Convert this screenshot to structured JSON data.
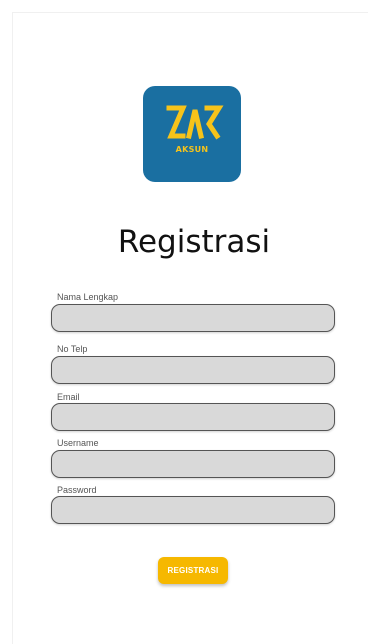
{
  "logo": {
    "text": "AKSUN",
    "background_color": "#1a6fa1",
    "accent_color": "#f6c31a"
  },
  "page": {
    "title": "Registrasi"
  },
  "form": {
    "fields": [
      {
        "label": "Nama Lengkap",
        "value": ""
      },
      {
        "label": "No Telp",
        "value": ""
      },
      {
        "label": "Email",
        "value": ""
      },
      {
        "label": "Username",
        "value": ""
      },
      {
        "label": "Password",
        "value": ""
      }
    ],
    "submit_label": "REGISTRASI",
    "submit_color": "#f6b800"
  }
}
